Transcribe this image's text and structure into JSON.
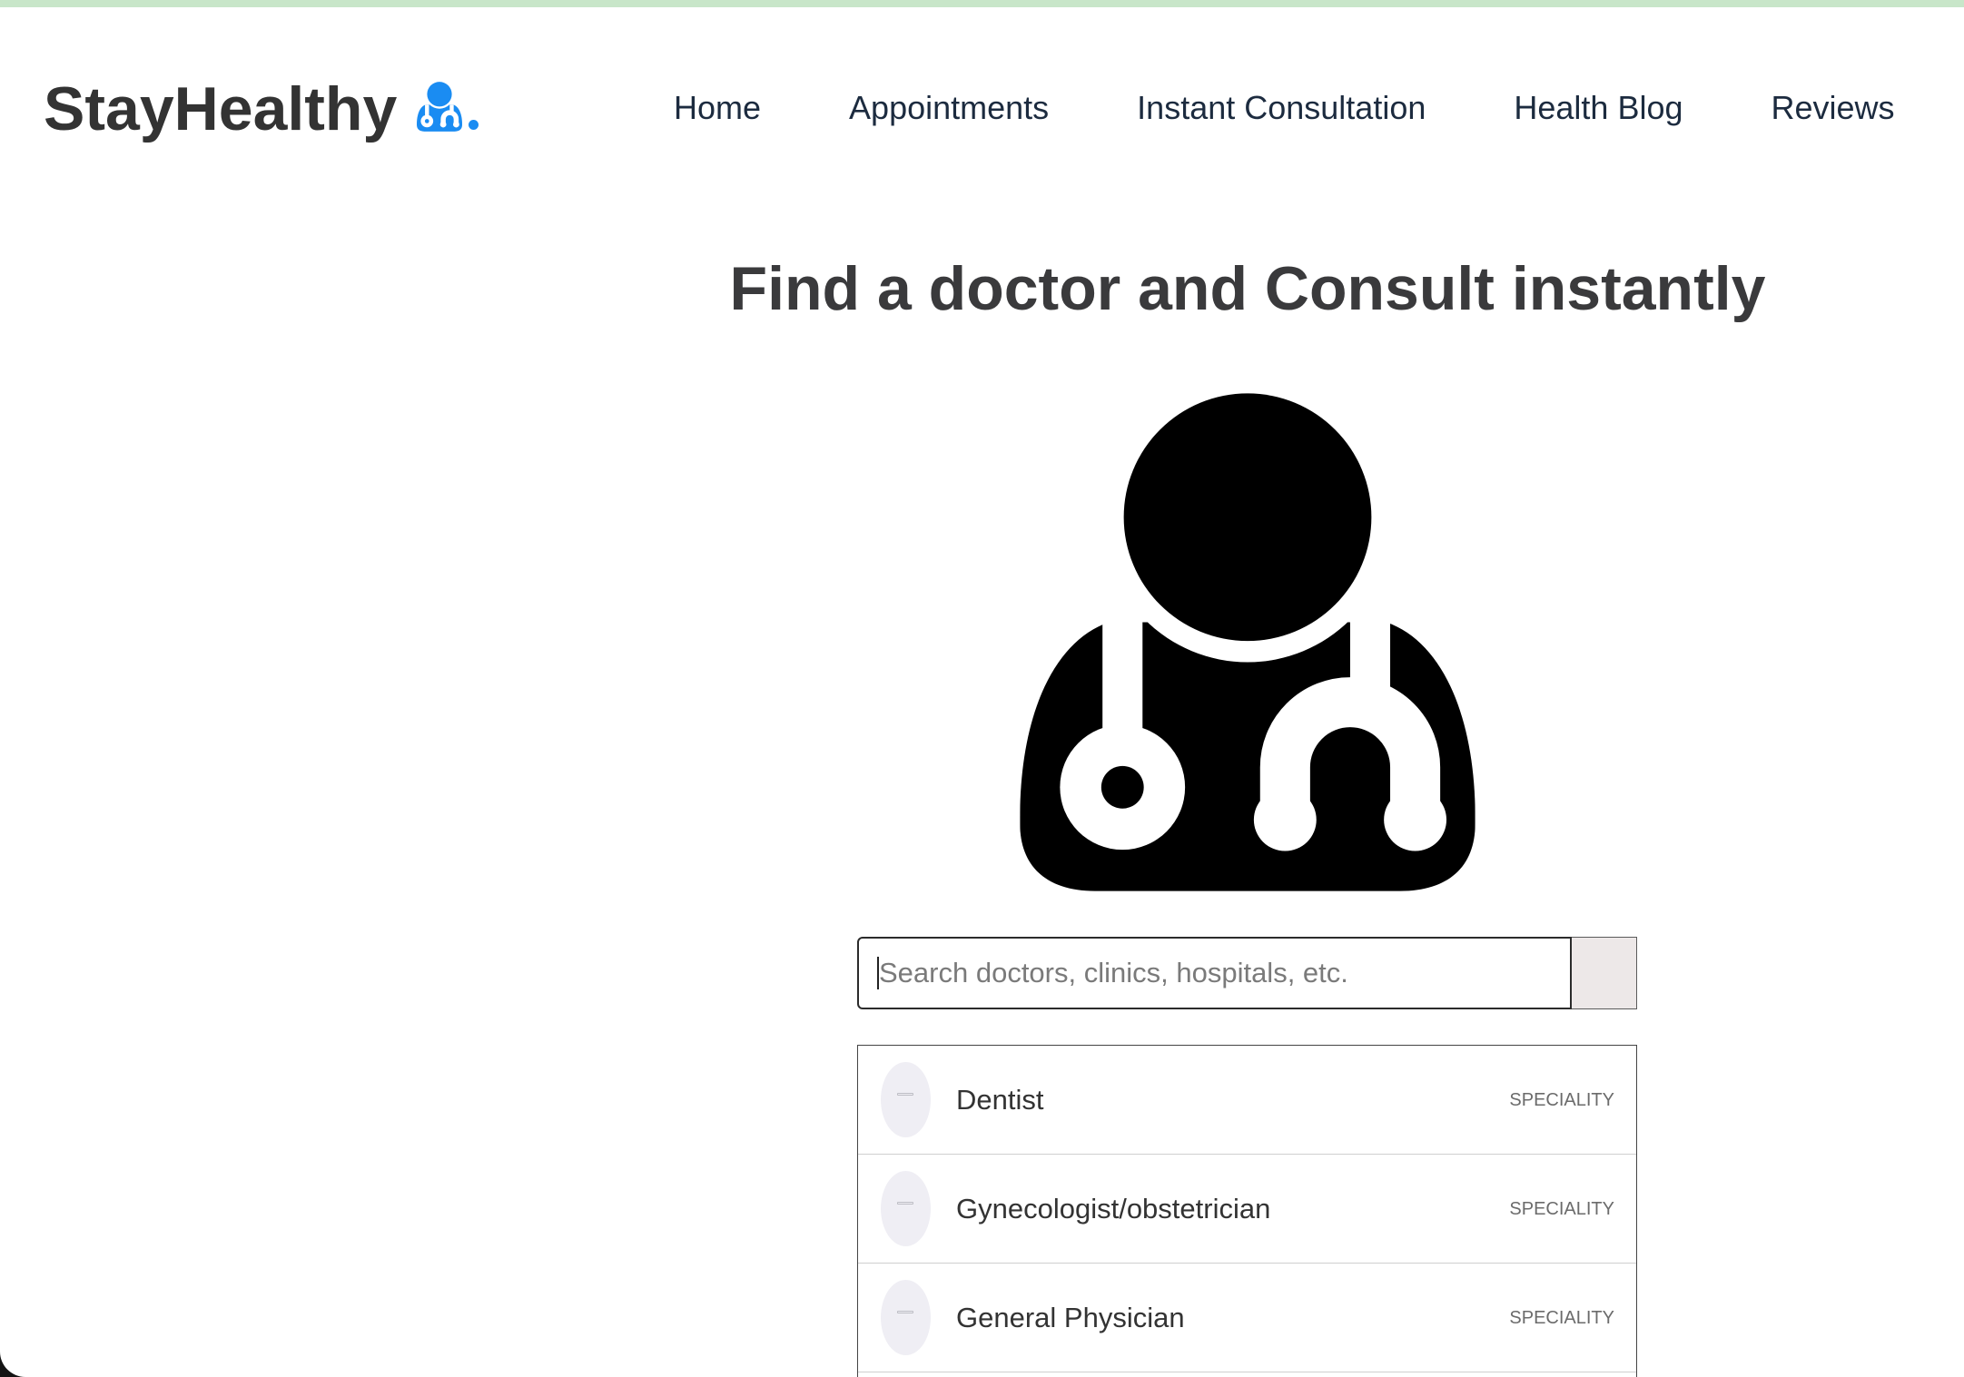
{
  "brand": {
    "name": "StayHealthy",
    "logo_icon": "user-doctor-icon"
  },
  "nav": {
    "items": [
      {
        "label": "Home"
      },
      {
        "label": "Appointments"
      },
      {
        "label": "Instant Consultation"
      },
      {
        "label": "Health Blog"
      },
      {
        "label": "Reviews"
      }
    ]
  },
  "hero": {
    "title": "Find a doctor and Consult instantly",
    "illustration_icon": "user-doctor-icon"
  },
  "search": {
    "placeholder": "Search doctors, clinics, hospitals, etc.",
    "value": ""
  },
  "results": [
    {
      "name": "Dentist",
      "type": "SPECIALITY"
    },
    {
      "name": "Gynecologist/obstetrician",
      "type": "SPECIALITY"
    },
    {
      "name": "General Physician",
      "type": "SPECIALITY"
    }
  ],
  "theme": {
    "accent": "#1a8cf2",
    "top_border": "#c8e6c9",
    "brand_text": "#333333",
    "nav_text": "#1c2b3f",
    "heading_text": "#3a3a3c",
    "body_text": "#333333",
    "muted_text": "#6b6b6b",
    "button_bg": "#ede8e8",
    "avatar_bg": "#efeef4"
  }
}
